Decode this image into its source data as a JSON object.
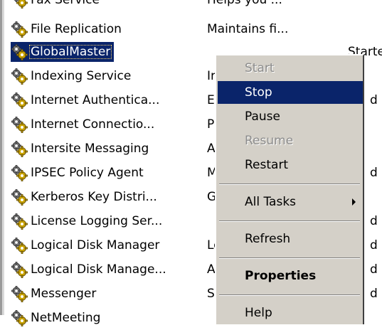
{
  "services": [
    {
      "name": "Fax Service",
      "description": "Helps you ...",
      "status": ""
    },
    {
      "name": "File Replication",
      "description": "Maintains fi...",
      "status": ""
    },
    {
      "name": "GlobalMaster",
      "description": "",
      "status": "Started"
    },
    {
      "name": "Indexing Service",
      "description": "Ir",
      "status": ""
    },
    {
      "name": "Internet Authentica...",
      "description": "E",
      "status": "d"
    },
    {
      "name": "Internet Connectio...",
      "description": "P",
      "status": ""
    },
    {
      "name": "Intersite Messaging",
      "description": "A",
      "status": ""
    },
    {
      "name": "IPSEC Policy Agent",
      "description": "M",
      "status": "d"
    },
    {
      "name": "Kerberos Key Distri...",
      "description": "G",
      "status": ""
    },
    {
      "name": "License Logging Ser...",
      "description": "",
      "status": "d"
    },
    {
      "name": "Logical Disk Manager",
      "description": "Lo",
      "status": "d"
    },
    {
      "name": "Logical Disk Manage...",
      "description": "A",
      "status": "d"
    },
    {
      "name": "Messenger",
      "description": "S",
      "status": "d"
    },
    {
      "name": "NetMeeting",
      "description": "",
      "status": ""
    }
  ],
  "context_menu": {
    "items": [
      {
        "label": "Start",
        "state": "disabled"
      },
      {
        "label": "Stop",
        "state": "highlighted"
      },
      {
        "label": "Pause",
        "state": "normal"
      },
      {
        "label": "Resume",
        "state": "disabled"
      },
      {
        "label": "Restart",
        "state": "normal"
      },
      {
        "label": "All Tasks",
        "state": "submenu"
      },
      {
        "label": "Refresh",
        "state": "normal"
      },
      {
        "label": "Properties",
        "state": "default"
      },
      {
        "label": "Help",
        "state": "normal"
      }
    ]
  },
  "colors": {
    "selection": "#0a246a",
    "menu_background": "#d4d0c8",
    "disabled_text": "#8c8c8c"
  },
  "icons": {
    "service": "gear-icon",
    "submenu": "chevron-right-icon"
  }
}
